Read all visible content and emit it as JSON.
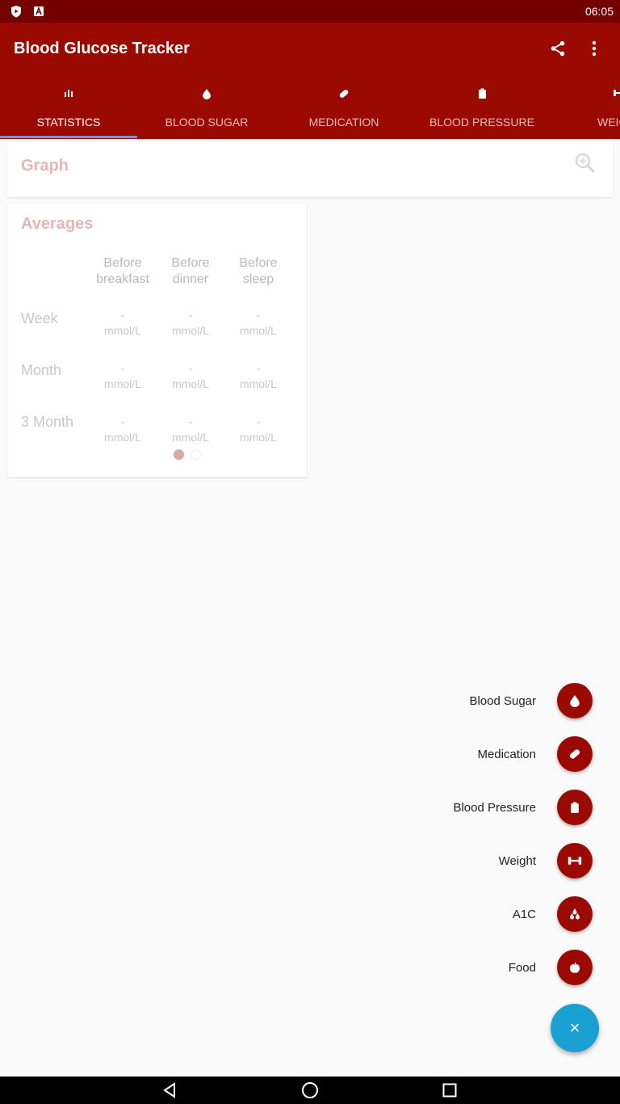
{
  "status_bar": {
    "time": "06:05",
    "icons": [
      "play-shield-icon",
      "a-box-icon"
    ]
  },
  "app_bar": {
    "title": "Blood Glucose Tracker",
    "actions": [
      "share-icon",
      "more-vert-icon"
    ],
    "color": "#9a0a03"
  },
  "tabs": [
    {
      "label": "STATISTICS",
      "icon": "bar-chart-icon",
      "active": true
    },
    {
      "label": "BLOOD SUGAR",
      "icon": "drop-icon"
    },
    {
      "label": "MEDICATION",
      "icon": "pill-icon"
    },
    {
      "label": "BLOOD PRESSURE",
      "icon": "clipboard-icon"
    },
    {
      "label": "WEIG",
      "icon": "dumbbell-icon"
    }
  ],
  "graph_card": {
    "title": "Graph",
    "icon": "zoom-icon"
  },
  "averages_card": {
    "title": "Averages",
    "columns": [
      "Before breakfast",
      "Before dinner",
      "Before sleep"
    ],
    "rows": [
      {
        "label": "Week",
        "values": [
          "-",
          "-",
          "-"
        ],
        "units": [
          "mmol/L",
          "mmol/L",
          "mmol/L"
        ]
      },
      {
        "label": "Month",
        "values": [
          "-",
          "-",
          "-"
        ],
        "units": [
          "mmol/L",
          "mmol/L",
          "mmol/L"
        ]
      },
      {
        "label": "3 Month",
        "values": [
          "-",
          "-",
          "-"
        ],
        "units": [
          "mmol/L",
          "mmol/L",
          "mmol/L"
        ]
      }
    ]
  },
  "fab_menu": [
    {
      "label": "Blood Sugar",
      "icon": "drop-icon"
    },
    {
      "label": "Medication",
      "icon": "pill-icon"
    },
    {
      "label": "Blood Pressure",
      "icon": "clipboard-icon"
    },
    {
      "label": "Weight",
      "icon": "dumbbell-icon"
    },
    {
      "label": "A1C",
      "icon": "drops-icon"
    },
    {
      "label": "Food",
      "icon": "apple-icon"
    }
  ],
  "main_fab": {
    "label": "×",
    "color": "#1aa1d1"
  },
  "nav_bar": [
    "back-icon",
    "home-icon",
    "recents-icon"
  ]
}
